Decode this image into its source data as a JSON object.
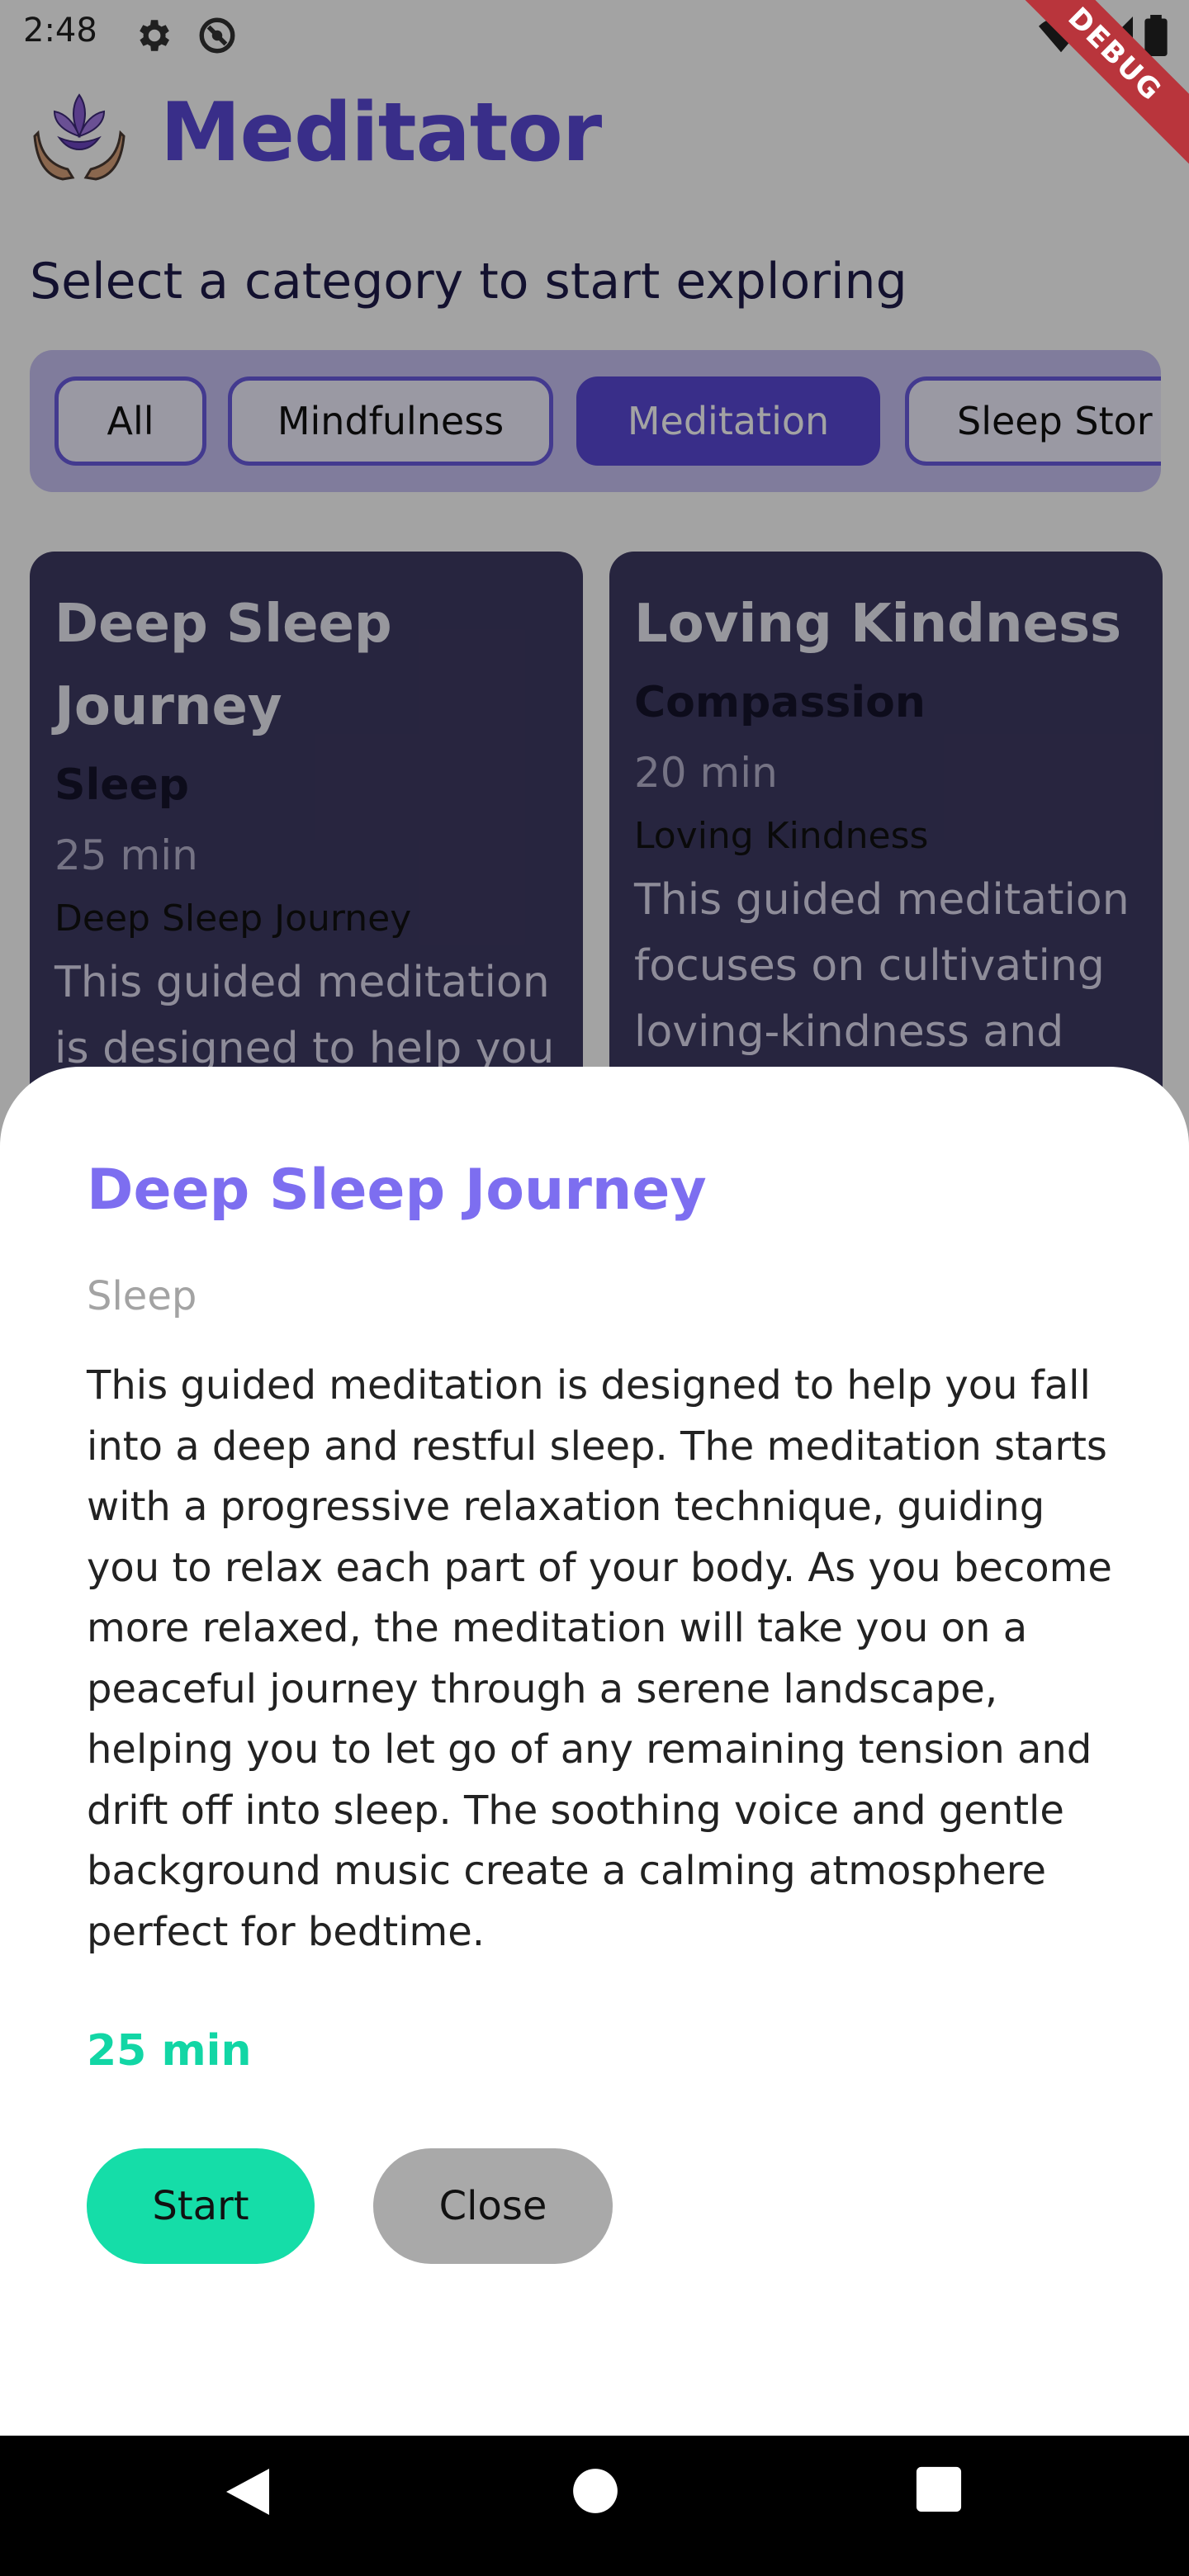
{
  "status_bar": {
    "time": "2:48"
  },
  "app": {
    "title": "Meditator",
    "subtitle": "Select a category to start exploring"
  },
  "categories": [
    {
      "label": "All"
    },
    {
      "label": "Mindfulness"
    },
    {
      "label": "Meditation",
      "selected": true
    },
    {
      "label": "Sleep Stor"
    }
  ],
  "cards": [
    {
      "title_line1": "Deep Sleep",
      "title_line2": "Journey",
      "category": "Sleep",
      "duration": "25 min",
      "name": "Deep Sleep Journey",
      "desc_line1": "This guided meditation",
      "desc_line2": "is designed to help you"
    },
    {
      "title_line1": "Loving Kindness",
      "category": "Compassion",
      "duration": "20 min",
      "name": "Loving Kindness",
      "desc_line1": "This guided meditation",
      "desc_line2": "focuses on cultivating",
      "desc_line3": "loving-kindness and"
    }
  ],
  "sheet": {
    "title": "Deep Sleep Journey",
    "category": "Sleep",
    "description": "This guided meditation is designed to help you fall into a deep and restful sleep. The meditation starts with a progressive relaxation technique, guiding you to relax each part of your body. As you become more relaxed, the meditation will take you on a peaceful journey through a serene landscape, helping you to let go of any remaining tension and drift off into sleep. The soothing voice and gentle background music create a calming atmosphere perfect for bedtime.",
    "duration": "25 min",
    "start_label": "Start",
    "close_label": "Close"
  },
  "debug_banner": "DEBUG",
  "colors": {
    "brand": "#5a48d6",
    "sheet_title": "#7d6ef0",
    "accent_green": "#15dda8",
    "card_bg": "#3e3a63",
    "close_button": "#a9a9a9"
  },
  "icons": {
    "status": [
      "gear-icon",
      "no-sync-icon",
      "wifi-icon",
      "signal-icon",
      "battery-icon"
    ],
    "logo": "lotus-hands-icon",
    "nav": [
      "back-icon",
      "home-icon",
      "recents-icon"
    ]
  }
}
